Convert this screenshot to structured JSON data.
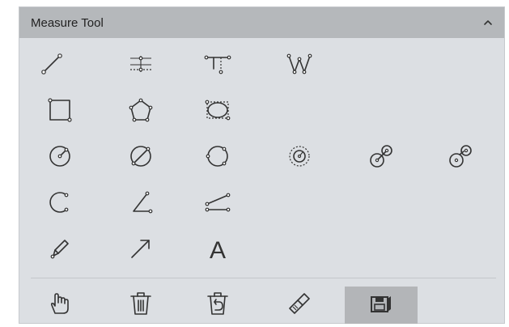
{
  "panel": {
    "title": "Measure Tool",
    "collapse_icon": "chevron-up-icon"
  },
  "tools": [
    {
      "row": 1,
      "items": [
        "line-tool",
        "parallel-lines-tool",
        "perpendicular-tool",
        "polyline-tool"
      ]
    },
    {
      "row": 2,
      "items": [
        "rectangle-tool",
        "polygon-tool",
        "ellipse-tool"
      ]
    },
    {
      "row": 3,
      "items": [
        "circle-center-radius-tool",
        "circle-diameter-tool",
        "circle-three-point-tool",
        "concentric-circles-tool",
        "two-circle-distance-tool",
        "two-circle-tangent-tool"
      ]
    },
    {
      "row": 4,
      "items": [
        "arc-tool",
        "angle-tool",
        "angle-two-lines-tool"
      ]
    },
    {
      "row": 5,
      "items": [
        "pen-tool",
        "arrow-tool",
        "text-tool"
      ]
    }
  ],
  "text_tool_label": "A",
  "bottom_toolbar": [
    "pan-hand-tool",
    "delete-tool",
    "undo-delete-tool",
    "clear-all-tool",
    "save-measurements-tool"
  ],
  "active_tool": "save-measurements-tool",
  "colors": {
    "panel_bg": "#dcdfe3",
    "header_bg": "#b5b8bb",
    "icon": "#333333",
    "active_bg": "#b3b5b8"
  }
}
